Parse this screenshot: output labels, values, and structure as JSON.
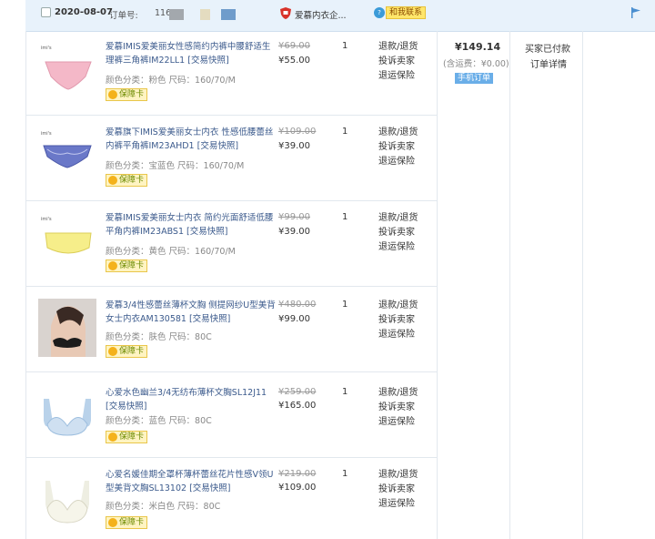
{
  "header": {
    "date": "2020-08-07",
    "order_label": "订单号:",
    "order_number_visible": "116",
    "shop_name": "爱慕内衣企...",
    "contact_label": "和我联系"
  },
  "items": [
    {
      "title": "爱慕IMIS爱美丽女性感简约内裤中腰舒适生理裤三角裤IM22LL1 [交易快照]",
      "attr": "颜色分类：粉色  尺码：160/70/M",
      "badge": "保障卡",
      "original_price": "¥69.00",
      "price": "¥55.00",
      "qty": "1",
      "actions": [
        "退款/退货",
        "投诉卖家",
        "退运保险"
      ]
    },
    {
      "title": "爱慕旗下IMIS爱美丽女士内衣 性感低腰蕾丝内裤平角裤IM23AHD1 [交易快照]",
      "attr": "颜色分类：宝蓝色  尺码：160/70/M",
      "badge": "保障卡",
      "original_price": "¥109.00",
      "price": "¥39.00",
      "qty": "1",
      "actions": [
        "退款/退货",
        "投诉卖家",
        "退运保险"
      ]
    },
    {
      "title": "爱慕IMIS爱美丽女士内衣 简约光面舒适低腰平角内裤IM23ABS1 [交易快照]",
      "attr": "颜色分类：黄色  尺码：160/70/M",
      "badge": "保障卡",
      "original_price": "¥99.00",
      "price": "¥39.00",
      "qty": "1",
      "actions": [
        "退款/退货",
        "投诉卖家",
        "退运保险"
      ]
    },
    {
      "title": "爱慕3/4性感蕾丝薄杯文胸 侧提网纱U型美背女士内衣AM130581 [交易快照]",
      "attr": "颜色分类：肤色  尺码：80C",
      "badge": "保障卡",
      "original_price": "¥480.00",
      "price": "¥99.00",
      "qty": "1",
      "actions": [
        "退款/退货",
        "投诉卖家",
        "退运保险"
      ]
    },
    {
      "title": "心爱水色幽兰3/4无纺布薄杯文胸SL12J11 [交易快照]",
      "attr": "颜色分类：蓝色  尺码：80C",
      "badge": "保障卡",
      "original_price": "¥259.00",
      "price": "¥165.00",
      "qty": "1",
      "actions": [
        "退款/退货",
        "投诉卖家",
        "退运保险"
      ]
    },
    {
      "title": "心爱名媛佳期全罩杯薄杯蕾丝花片性感V领U型美背文胸SL13102 [交易快照]",
      "attr": "颜色分类：米白色  尺码：80C",
      "badge": "保障卡",
      "original_price": "¥219.00",
      "price": "¥109.00",
      "qty": "1",
      "actions": [
        "退款/退货",
        "投诉卖家",
        "退运保险"
      ]
    }
  ],
  "order_total": {
    "total": "¥149.14",
    "shipping": "(含运费：¥0.00)",
    "mobile_tag": "手机订单",
    "status": "买家已付款",
    "detail_link": "订单详情"
  },
  "colors": {
    "header_bg": "#e8f2fb",
    "title_link": "#3b5a8c",
    "badge_bg": "#fff4c2",
    "mobile_tag_bg": "#6aaee8"
  }
}
